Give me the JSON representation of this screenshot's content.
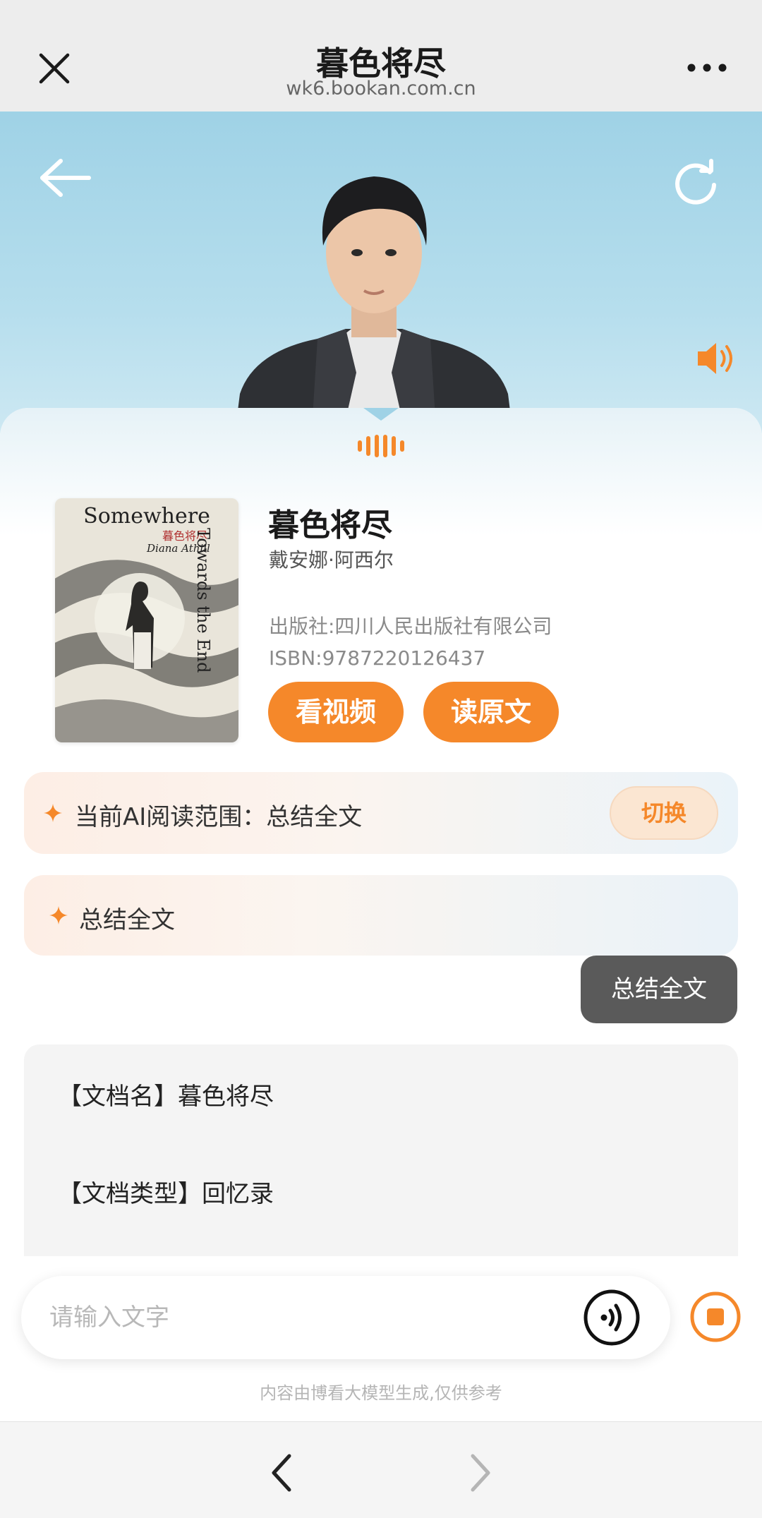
{
  "browser": {
    "title": "暮色将尽",
    "url": "wk6.bookan.com.cn"
  },
  "book": {
    "title": "暮色将尽",
    "author": "戴安娜·阿西尔",
    "publisher": "出版社:四川人民出版社有限公司",
    "isbn": "ISBN:9787220126437",
    "cover": {
      "title": "Somewhere",
      "cn_title": "暮色将尽",
      "author": "Diana Athill",
      "subtitle": "Towards the End"
    }
  },
  "buttons": {
    "video": "看视频",
    "read": "读原文",
    "switch": "切换"
  },
  "scope": {
    "label": "当前AI阅读范围：总结全文"
  },
  "suggestion": {
    "label": "总结全文"
  },
  "chat": {
    "user_message": "总结全文",
    "answer_line1": "【文档名】暮色将尽",
    "answer_line2": "【文档类型】回忆录"
  },
  "input": {
    "placeholder": "请输入文字"
  },
  "disclaimer": "内容由博看大模型生成,仅供参考",
  "colors": {
    "accent": "#f5882a",
    "bubble": "#5a5a5a"
  },
  "icons": [
    "close-icon",
    "more-icon",
    "back-arrow-icon",
    "refresh-icon",
    "speaker-icon",
    "sparkle-icon",
    "voice-icon",
    "stop-icon",
    "chevron-left-icon",
    "chevron-right-icon"
  ]
}
